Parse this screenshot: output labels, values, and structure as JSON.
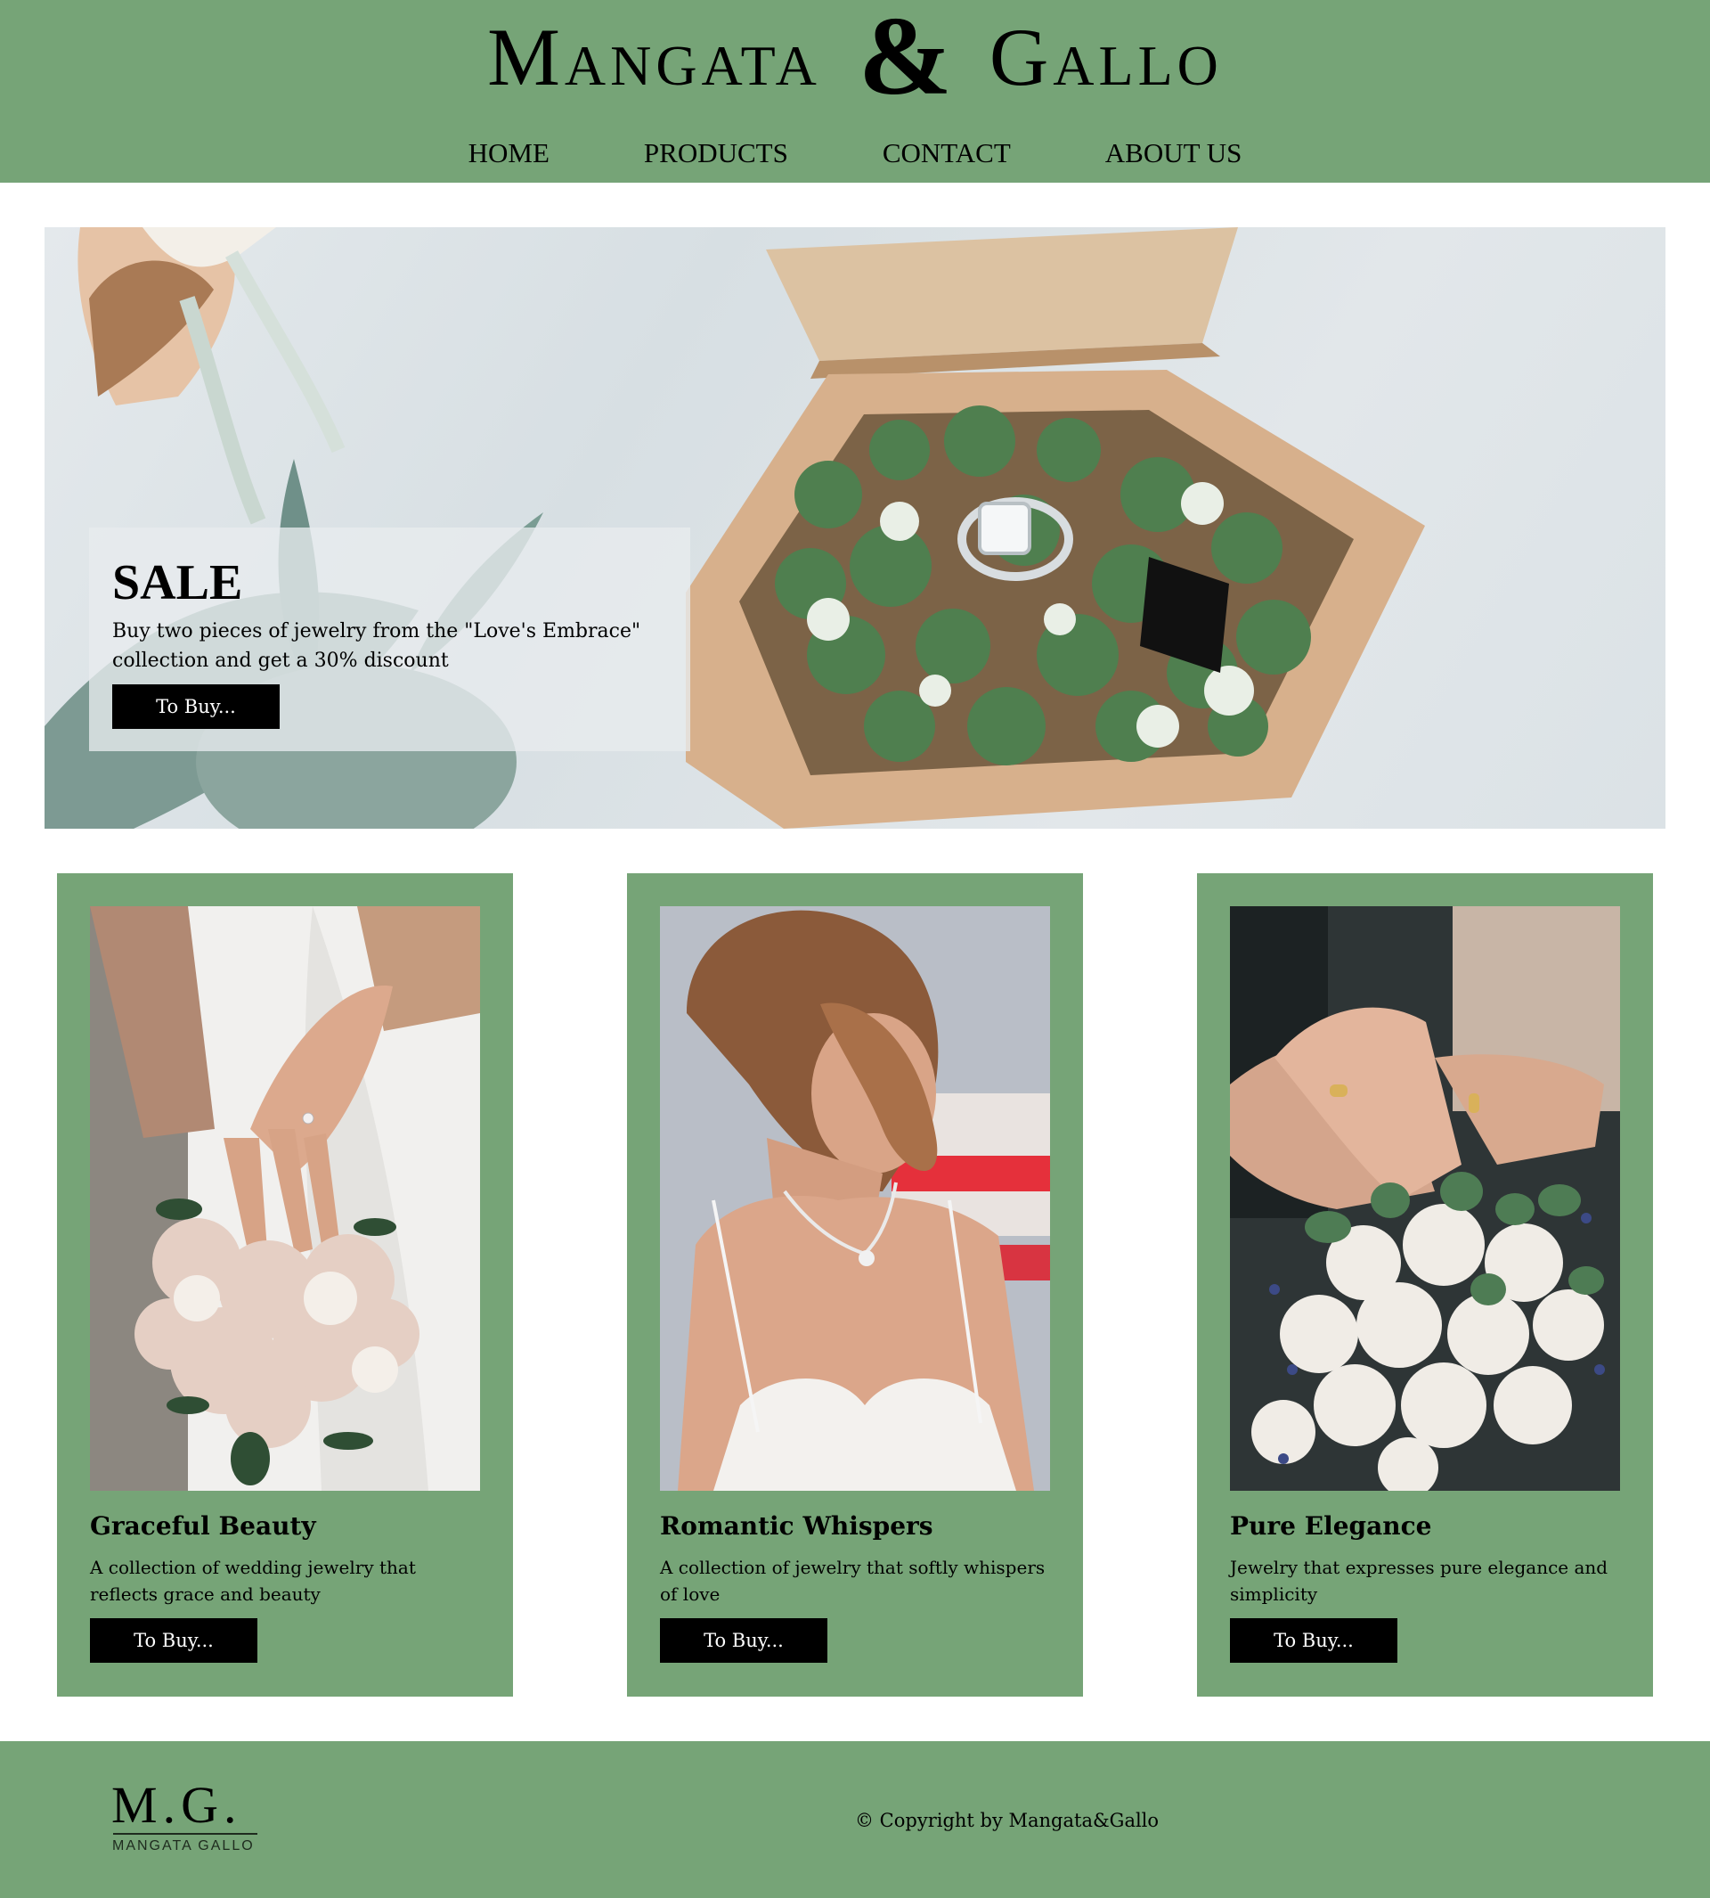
{
  "header": {
    "brand_left": "Mangata",
    "brand_amp": "&",
    "brand_right": "Gallo",
    "nav": [
      "HOME",
      "PRODUCTS",
      "CONTACT",
      "ABOUT US"
    ]
  },
  "hero": {
    "title": "SALE",
    "text": "Buy two pieces of jewelry from the \"Love's Embrace\" collection and get a 30% discount",
    "button": "To Buy..."
  },
  "cards": [
    {
      "title": "Graceful Beauty",
      "desc": "A collection of wedding jewelry that reflects grace and beauty",
      "button": "To Buy..."
    },
    {
      "title": "Romantic Whispers",
      "desc": "A collection of jewelry that softly whispers of love",
      "button": "To Buy..."
    },
    {
      "title": "Pure Elegance",
      "desc": "Jewelry that expresses pure elegance and simplicity",
      "button": "To Buy..."
    }
  ],
  "footer": {
    "logo_mark": "M.G.",
    "logo_sub": "MANGATA GALLO",
    "copyright": "© Copyright by Mangata&Gallo"
  },
  "colors": {
    "accent_green": "#76a477",
    "button_bg": "#000000",
    "button_text": "#ffffff"
  }
}
